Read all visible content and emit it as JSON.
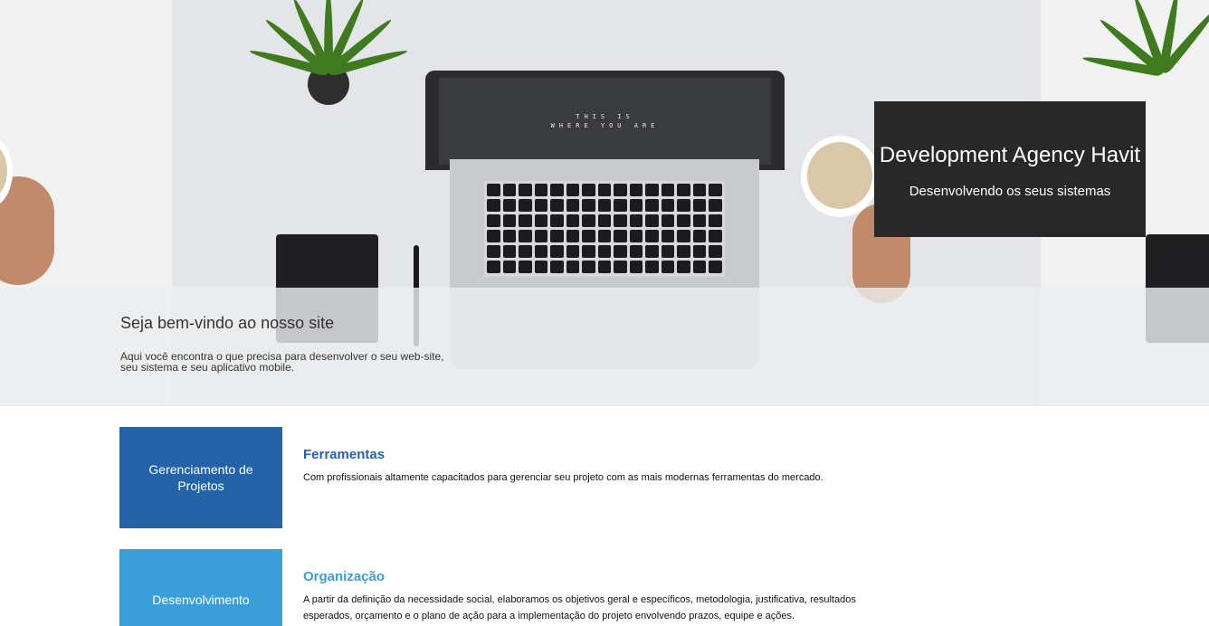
{
  "hero": {
    "screen_line1": "THIS IS",
    "screen_line2": "WHERE YOU ARE",
    "brand_title": "Development Agency Havit",
    "brand_subtitle": "Desenvolvendo os seus sistemas",
    "welcome_title": "Seja bem-vindo ao nosso site",
    "welcome_text": "Aqui você encontra o que precisa para desenvolver o seu web-site, seu sistema e seu aplicativo mobile."
  },
  "services": [
    {
      "box_label": "Gerenciamento de Projetos",
      "box_color": "#2563a8",
      "title": "Ferramentas",
      "title_color": "#2563a8",
      "text": "Com profissionais altamente capacitados para gerenciar seu projeto com as mais modernas ferramentas do mercado."
    },
    {
      "box_label": "Desenvolvimento",
      "box_color": "#3a9fd8",
      "title": "Organização",
      "title_color": "#3a9fd8",
      "text": "A partir da definição da necessidade social, elaboramos os objetivos geral e específicos, metodologia, justificativa, resultados esperados, orçamento e o plano de ação para a implementação do projeto envolvendo prazos, equipe e ações."
    }
  ]
}
